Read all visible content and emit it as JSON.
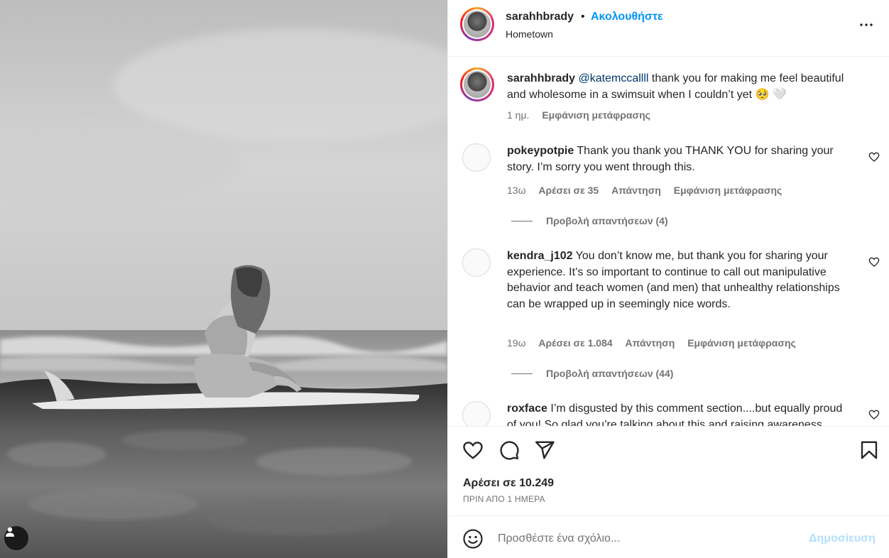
{
  "post": {
    "username": "sarahhbrady",
    "separator": "•",
    "follow_label": "Ακολουθήστε",
    "location": "Hometown"
  },
  "caption": {
    "username": "sarahhbrady",
    "mention": "@katemccallll",
    "text": " thank you for making me feel beautiful and wholesome in a swimsuit when I couldn’t yet 🥺 🤍",
    "time": "1 ημ.",
    "translate_label": "Εμφάνιση μετάφρασης"
  },
  "comments": [
    {
      "username": "pokeypotpie",
      "text": " Thank you thank you THANK YOU for sharing your story. I’m sorry you went through this.",
      "time": "13ω",
      "likes": "Αρέσει σε 35",
      "reply_label": "Απάντηση",
      "translate_label": "Εμφάνιση μετάφρασης",
      "view_replies": "Προβολή απαντήσεων (4)"
    },
    {
      "username": "kendra_j102",
      "text": " You don’t know me, but thank you for sharing your experience. It’s so important to continue to call out manipulative behavior and teach women (and men) that unhealthy relationships can be wrapped up in seemingly nice words.",
      "time": "19ω",
      "likes": "Αρέσει σε 1.084",
      "reply_label": "Απάντηση",
      "translate_label": "Εμφάνιση μετάφρασης",
      "view_replies": "Προβολή απαντήσεων (44)"
    },
    {
      "username": "roxface",
      "text": " I’m disgusted by this comment section....but equally proud of you! So glad you’re talking about this and raising awareness."
    }
  ],
  "footer": {
    "likes": "Αρέσει σε 10.249",
    "date": "ΠΡΙΝ ΑΠΟ 1 ΗΜΕΡΑ"
  },
  "add_comment": {
    "placeholder": "Προσθέστε ένα σχόλιο...",
    "post_label": "Δημοσίευση"
  },
  "colors": {
    "accent": "#0095f6",
    "mention": "#00376b",
    "muted": "#737373",
    "post_disabled": "#b2dffc"
  },
  "icons": [
    "user-tag-icon",
    "more-options-icon",
    "heart-icon",
    "comment-icon",
    "share-icon",
    "bookmark-icon",
    "emoji-icon"
  ]
}
